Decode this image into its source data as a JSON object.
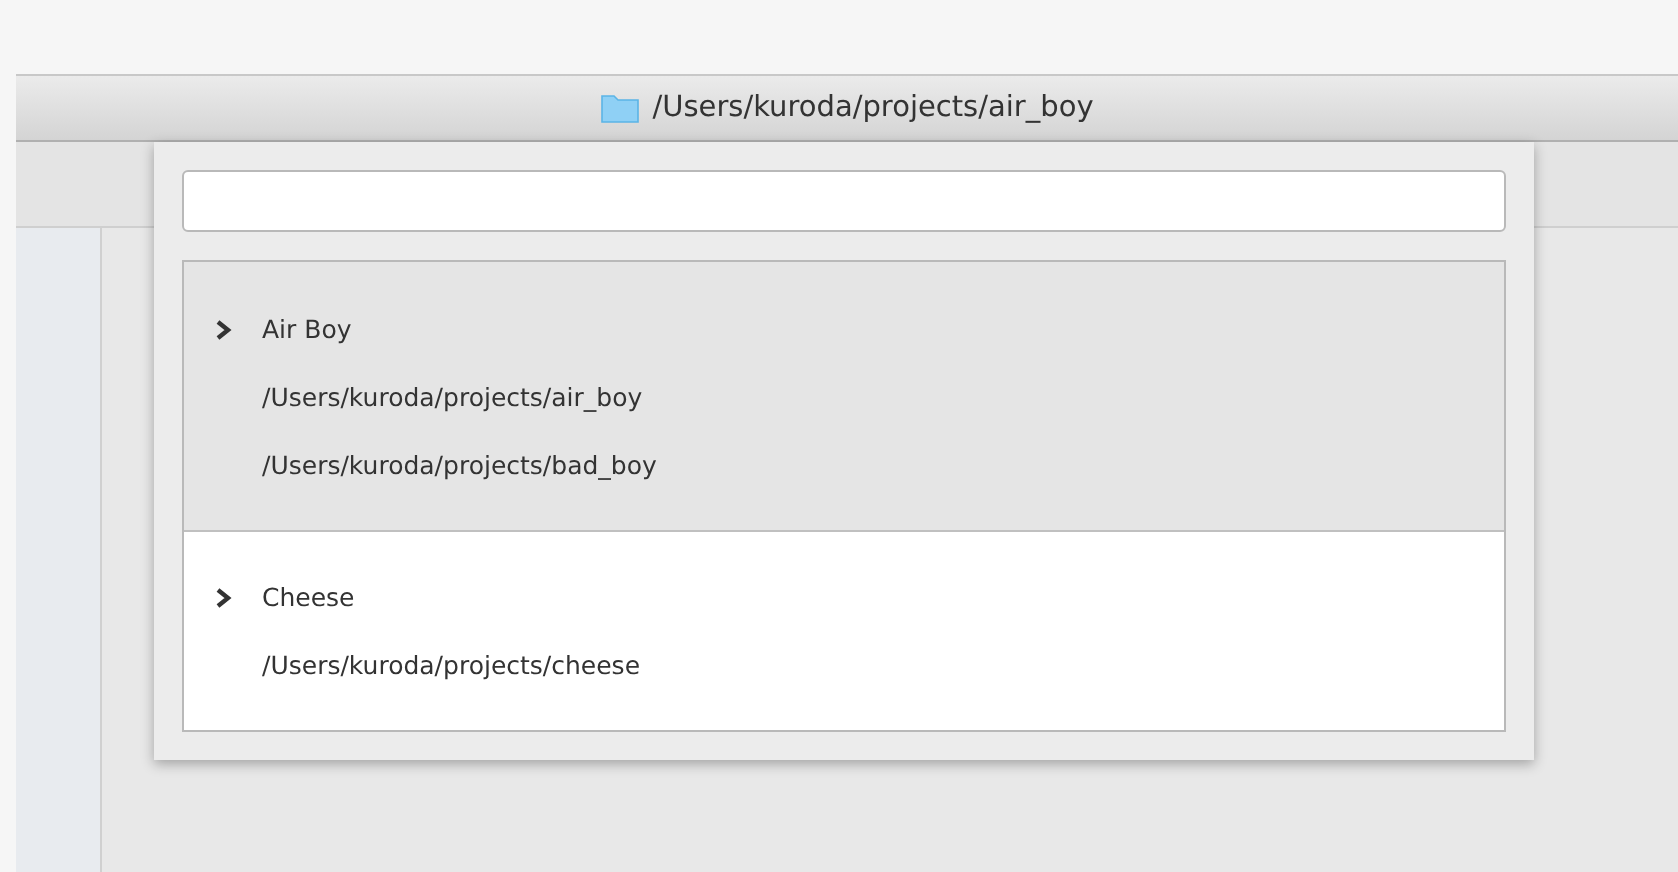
{
  "window": {
    "title": "/Users/kuroda/projects/air_boy"
  },
  "groups": [
    {
      "title": "Air Boy",
      "selected": true,
      "paths": [
        "/Users/kuroda/projects/air_boy",
        "/Users/kuroda/projects/bad_boy"
      ]
    },
    {
      "title": "Cheese",
      "selected": false,
      "paths": [
        "/Users/kuroda/projects/cheese"
      ]
    }
  ]
}
